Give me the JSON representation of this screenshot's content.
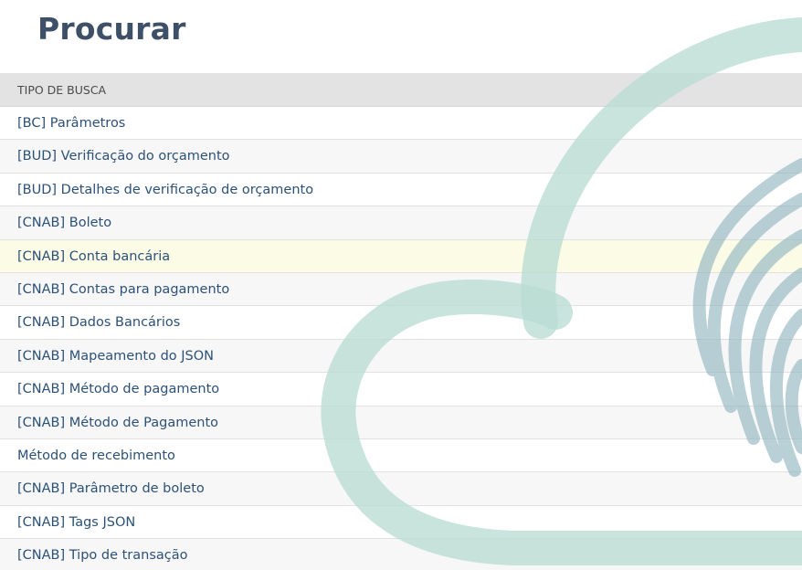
{
  "page": {
    "title": "Procurar"
  },
  "table": {
    "header": "TIPO DE BUSCA",
    "rows": [
      "[BC] Parâmetros",
      "[BUD] Verificação do orçamento",
      "[BUD] Detalhes de verificação de orçamento",
      "[CNAB] Boleto",
      "[CNAB] Conta bancária",
      "[CNAB] Contas para pagamento",
      "[CNAB] Dados Bancários",
      "[CNAB] Mapeamento do JSON",
      "[CNAB] Método de pagamento",
      "[CNAB] Método de Pagamento",
      "Método de recebimento",
      "[CNAB] Parâmetro de boleto",
      "[CNAB] Tags JSON",
      "[CNAB] Tipo de transação"
    ],
    "highlighted_row": 4
  },
  "colors": {
    "title": "#3e5068",
    "link": "#2c5178",
    "header_bg": "#e3e3e3",
    "highlight_bg": "#fbfbe6",
    "watermark_cloud": "#b8dcd4",
    "watermark_fingerprint": "#8fb4c0"
  },
  "icons": {
    "watermark": "cloud-fingerprint-logo"
  }
}
